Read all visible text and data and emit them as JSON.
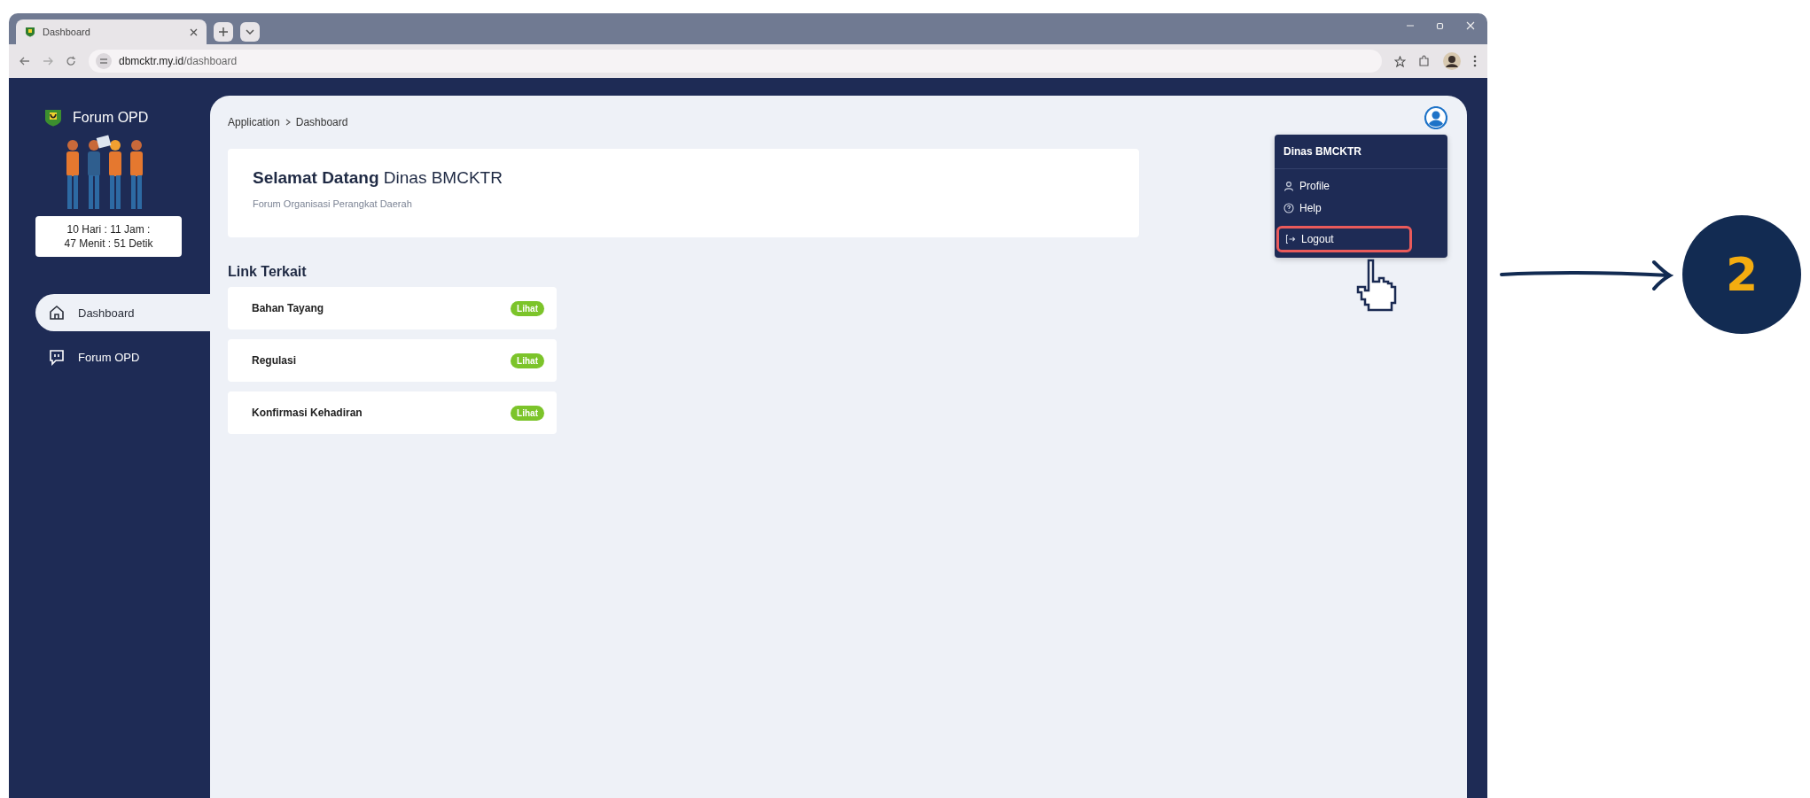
{
  "browser": {
    "tab": {
      "title": "Dashboard"
    },
    "address": {
      "domain": "dbmcktr.my.id",
      "path": "/dashboard"
    }
  },
  "sidebar": {
    "brand": "Forum OPD",
    "countdown": [
      "10 Hari : 11 Jam :",
      "47 Menit : 51 Detik"
    ],
    "nav": [
      {
        "label": "Dashboard",
        "kind": "home",
        "selected": true
      },
      {
        "label": "Forum OPD",
        "kind": "chat",
        "selected": false
      }
    ]
  },
  "breadcrumb": [
    "Application",
    "Dashboard"
  ],
  "welcome": {
    "title": "**Selamat Datang** Dinas BMCKTR",
    "subtitle": "Forum Organisasi Perangkat Daerah"
  },
  "links": {
    "title": "Link Terkait",
    "items": [
      {
        "label": "Bahan Tayang",
        "button": "Lihat"
      },
      {
        "label": "Regulasi",
        "button": "Lihat"
      },
      {
        "label": "Konfirmasi Kehadiran",
        "button": "Lihat"
      }
    ]
  },
  "user_menu": {
    "name": "Dinas BMCKTR",
    "items": [
      {
        "label": "Profile",
        "kind": "profile",
        "highlighted": false
      },
      {
        "label": "Help",
        "kind": "help",
        "highlighted": false
      },
      {
        "label": "Logout",
        "kind": "logout",
        "highlighted": true
      }
    ]
  },
  "annotation": {
    "step": "2"
  }
}
